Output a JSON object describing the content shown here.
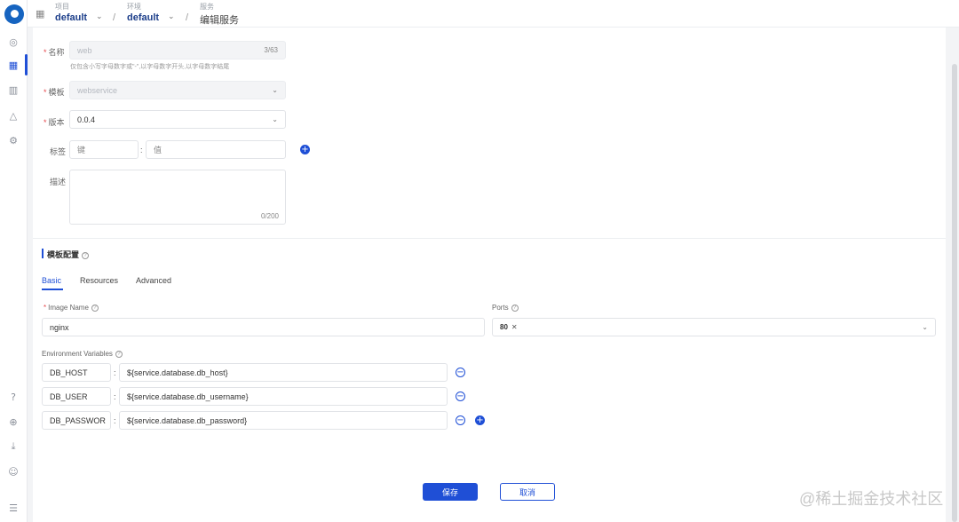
{
  "topbar": {
    "project_label": "项目",
    "project_value": "default",
    "env_label": "环境",
    "env_value": "default",
    "service_label": "服务",
    "service_value": "编辑服务",
    "separator": "/"
  },
  "form": {
    "name": {
      "label": "名称",
      "value": "web",
      "count": "3/63",
      "hint": "仅包含小写字母数字或\"-\",以字母数字开头,以字母数字结尾"
    },
    "template": {
      "label": "模板",
      "value": "webservice"
    },
    "version": {
      "label": "版本",
      "value": "0.0.4"
    },
    "tags": {
      "label": "标签",
      "key_placeholder": "键",
      "value_placeholder": "值",
      "colon": ":"
    },
    "description": {
      "label": "描述",
      "count": "0/200"
    }
  },
  "template_config": {
    "title": "模板配置",
    "help_icon": "question-circle-icon",
    "tabs": [
      {
        "label": "Basic",
        "active": true
      },
      {
        "label": "Resources",
        "active": false
      },
      {
        "label": "Advanced",
        "active": false
      }
    ],
    "image_name": {
      "label": "Image Name",
      "value": "nginx"
    },
    "ports": {
      "label": "Ports",
      "tags": [
        "80"
      ]
    },
    "env_vars": {
      "label": "Environment Variables",
      "rows": [
        {
          "key": "DB_HOST",
          "value": "${service.database.db_host}"
        },
        {
          "key": "DB_USER",
          "value": "${service.database.db_username}"
        },
        {
          "key": "DB_PASSWOR",
          "value": "${service.database.db_password}"
        }
      ]
    }
  },
  "actions": {
    "save": "保存",
    "cancel": "取消"
  },
  "watermark": "@稀土掘金技术社区",
  "colors": {
    "accent": "#1f4fd6",
    "required": "#e5484d",
    "brand": "#1664c0"
  },
  "sidebar_icons": [
    "rocket-icon",
    "apps-grid-icon",
    "bar-chart-icon",
    "warning-icon",
    "gear-icon",
    "help-icon",
    "globe-icon",
    "download-icon",
    "user-circle-icon",
    "menu-collapse-icon"
  ]
}
